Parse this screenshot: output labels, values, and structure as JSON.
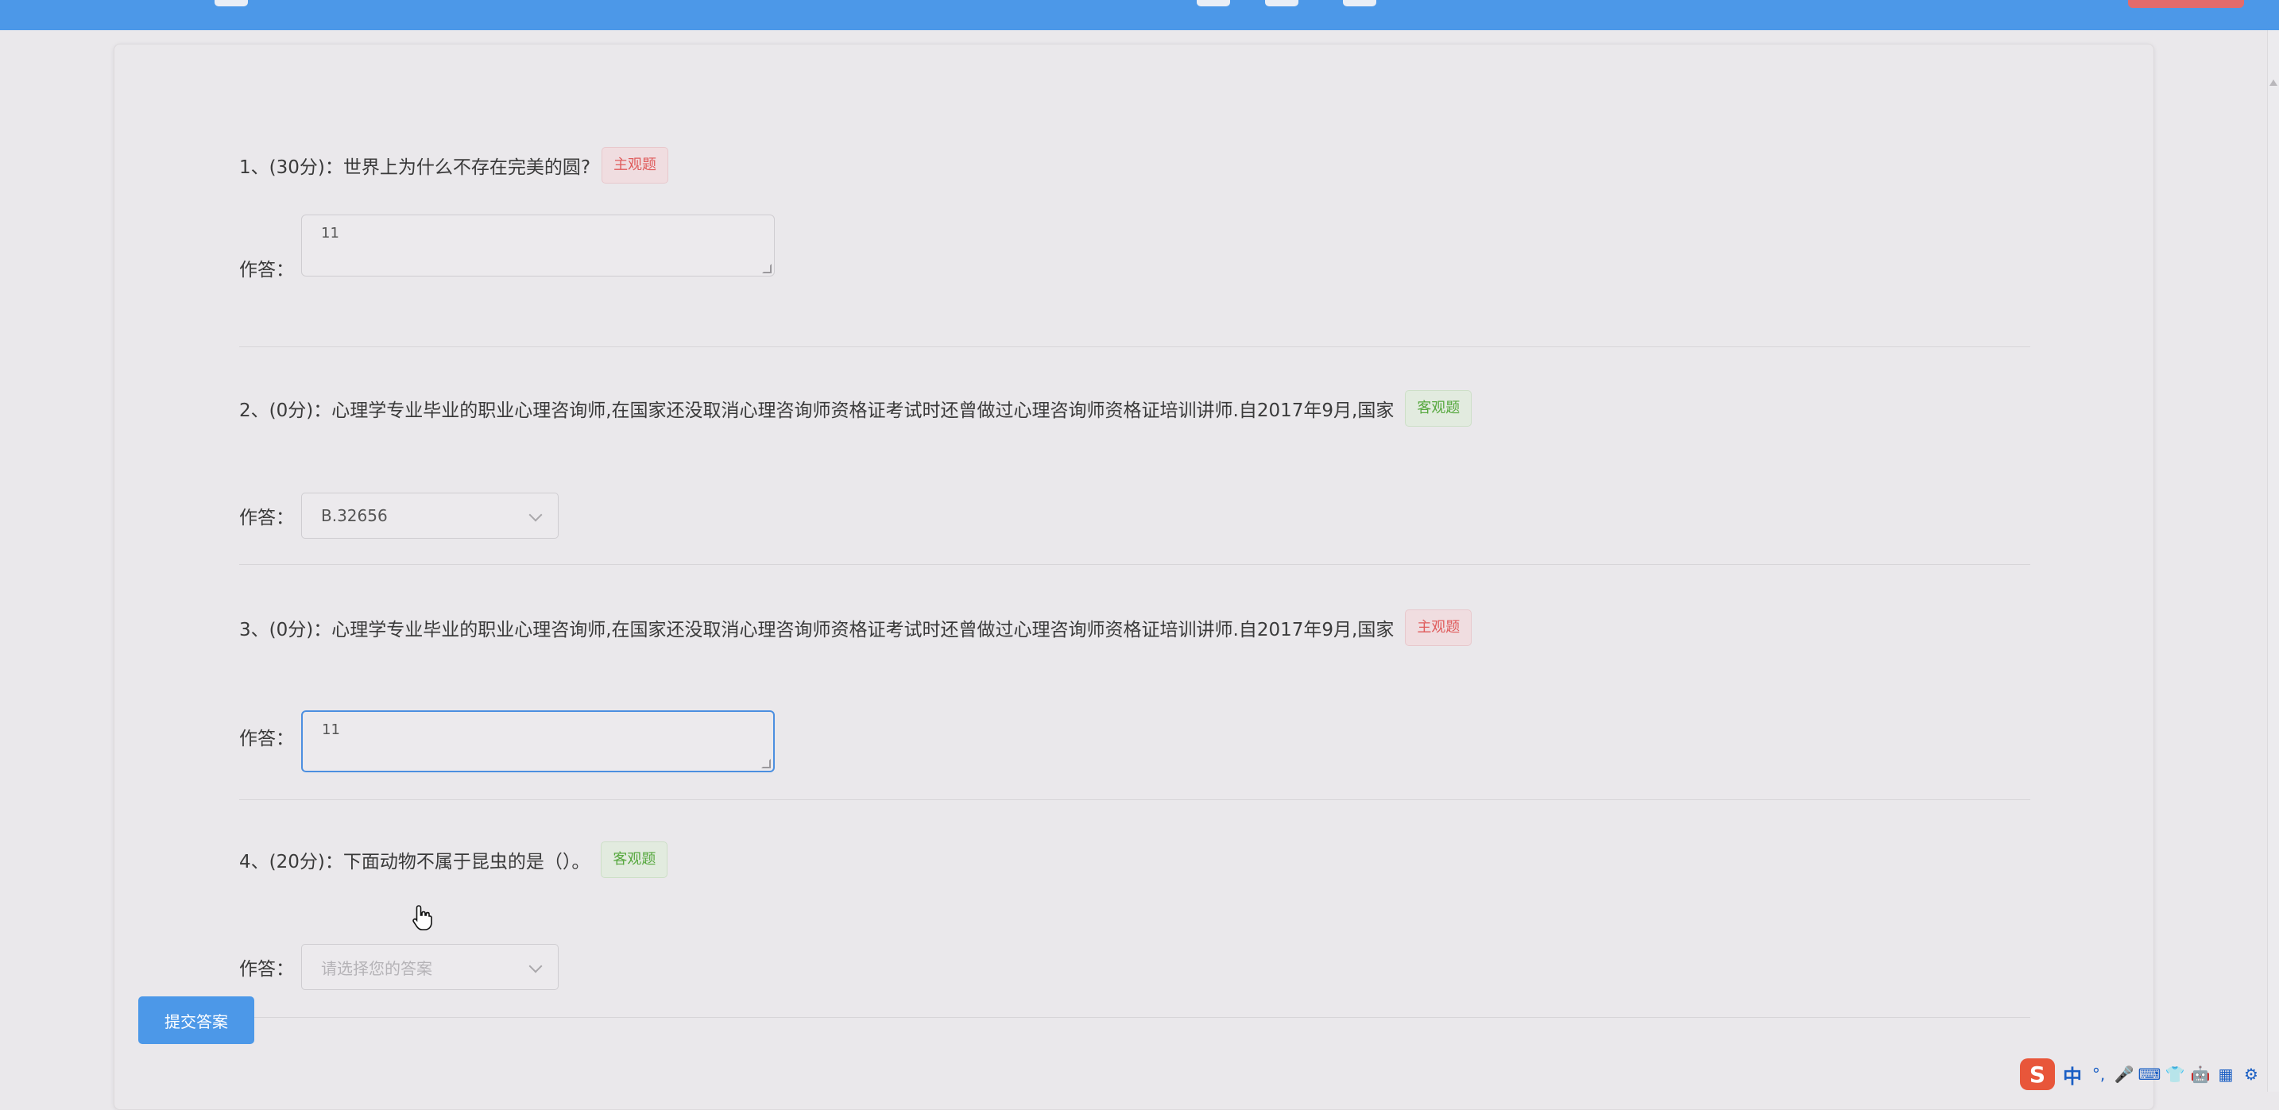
{
  "questions": [
    {
      "title": "1、(30分)：世界上为什么不存在完美的圆?",
      "tag": "主观题",
      "answer_label": "作答：",
      "answer_value": "11"
    },
    {
      "title": "2、(0分)：心理学专业毕业的职业心理咨询师,在国家还没取消心理咨询师资格证考试时还曾做过心理咨询师资格证培训讲师.自2017年9月,国家",
      "tag": "客观题",
      "answer_label": "作答：",
      "answer_value": "B.32656"
    },
    {
      "title": "3、(0分)：心理学专业毕业的职业心理咨询师,在国家还没取消心理咨询师资格证考试时还曾做过心理咨询师资格证培训讲师.自2017年9月,国家",
      "tag": "主观题",
      "answer_label": "作答：",
      "answer_value": "11"
    },
    {
      "title": "4、(20分)：下面动物不属于昆虫的是（）。",
      "tag": "客观题",
      "answer_label": "作答：",
      "answer_placeholder": "请选择您的答案"
    }
  ],
  "submit_label": "提交答案",
  "tray": {
    "sogou": "S",
    "zh": "中",
    "icons": [
      "°,",
      "🎤",
      "⌨",
      "👕",
      "🤖",
      "▦",
      "⚙"
    ]
  },
  "colors": {
    "topbar": "#4c98e8",
    "primary": "#4c98e8",
    "subjective_tag": "#df5c5c",
    "objective_tag": "#57a83f"
  }
}
